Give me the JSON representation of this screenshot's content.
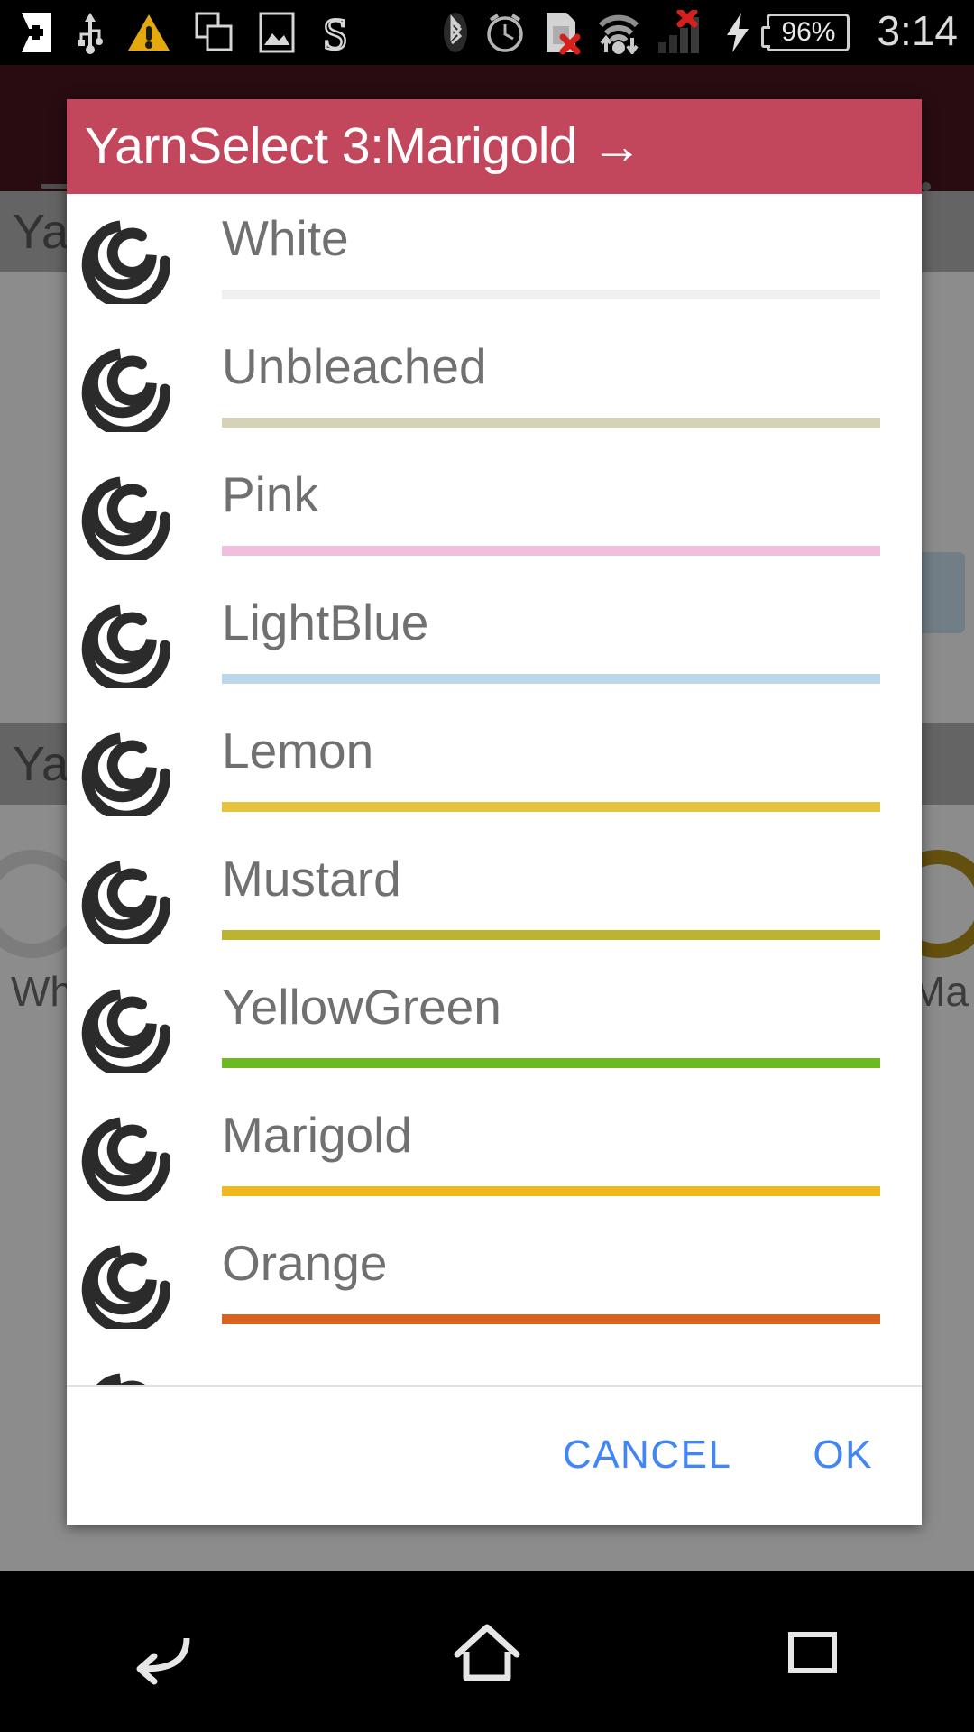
{
  "status_bar": {
    "time": "3:14",
    "battery_percent": "96%",
    "icons_left": [
      "first-aid-icon",
      "usb-icon",
      "warning-triangle-icon",
      "copy-windows-icon",
      "image-icon",
      "s-logo-icon"
    ],
    "icons_right": [
      "bluetooth-icon",
      "alarm-clock-icon",
      "sim-card-error-icon",
      "wifi-transfer-icon",
      "signal-bars-error-icon",
      "charging-bolt-icon",
      "battery-icon"
    ]
  },
  "app_behind": {
    "hamburger": "menu-icon",
    "overflow": "overflow-menu-icon",
    "row1_label": "Yar",
    "row2_label": "Yar",
    "swatch_left_label": "Wh",
    "swatch_right_label": "Ma"
  },
  "dialog": {
    "title": "YarnSelect 3:Marigold →",
    "title_bg": "#c2475d",
    "items": [
      {
        "label": "White",
        "color": "#f0f0f0",
        "icon": "yarn-spiral-icon"
      },
      {
        "label": "Unbleached",
        "color": "#d5d2b8",
        "icon": "yarn-spiral-icon"
      },
      {
        "label": "Pink",
        "color": "#f2bede",
        "icon": "yarn-spiral-icon"
      },
      {
        "label": "LightBlue",
        "color": "#bdd7ea",
        "icon": "yarn-spiral-icon"
      },
      {
        "label": "Lemon",
        "color": "#e5c33c",
        "icon": "yarn-spiral-icon"
      },
      {
        "label": "Mustard",
        "color": "#bcb430",
        "icon": "yarn-spiral-icon"
      },
      {
        "label": "YellowGreen",
        "color": "#6cba21",
        "icon": "yarn-spiral-icon"
      },
      {
        "label": "Marigold",
        "color": "#f0b81c",
        "icon": "yarn-spiral-icon"
      },
      {
        "label": "Orange",
        "color": "#d9621e",
        "icon": "yarn-spiral-icon"
      }
    ],
    "cancel_label": "CANCEL",
    "ok_label": "OK",
    "button_color": "#4285f4"
  },
  "nav_bar": {
    "back": "back-arrow-icon",
    "home": "home-icon",
    "recents": "recent-apps-icon"
  }
}
